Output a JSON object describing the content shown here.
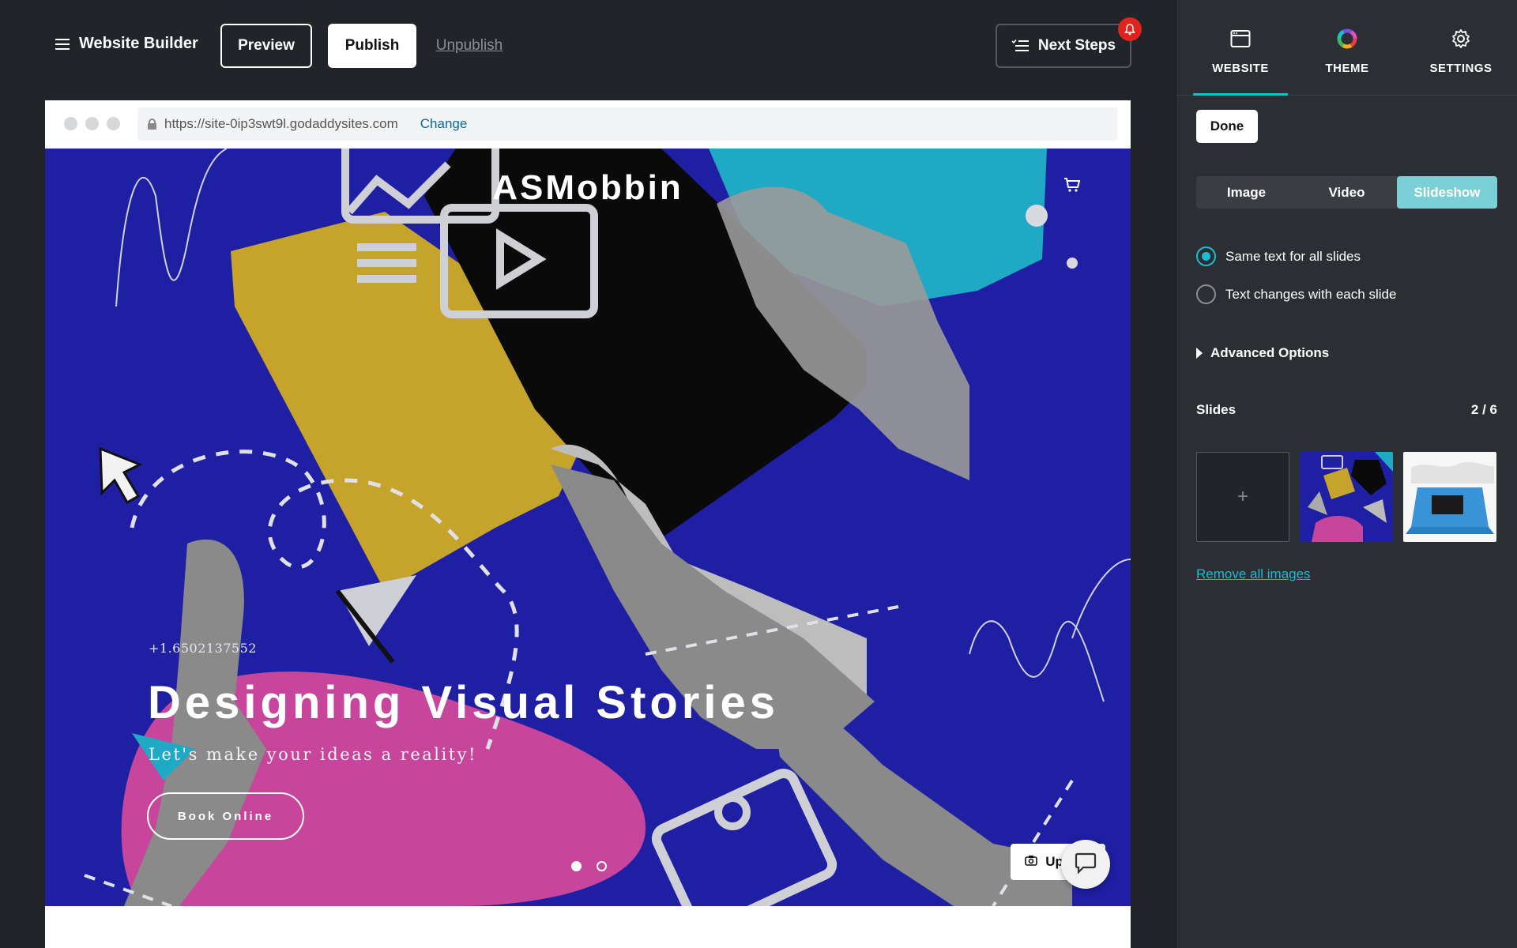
{
  "topbar": {
    "brand": "Website Builder",
    "preview_label": "Preview",
    "publish_label": "Publish",
    "unpublish_label": "Unpublish",
    "next_steps_label": "Next Steps",
    "bell_icon": "bell-icon"
  },
  "browser": {
    "url": "https://site-0ip3swt9l.godaddysites.com",
    "change_label": "Change"
  },
  "hero": {
    "site_title": "ASMobbin",
    "phone": "+1.6502137552",
    "headline": "Designing Visual Stories",
    "subline": "Let's make your ideas a reality!",
    "cta_label": "Book Online",
    "update_label": "Update",
    "slide_dots": 2,
    "active_slide_dot": 1
  },
  "panel": {
    "tabs": [
      {
        "label": "WEBSITE",
        "icon": "browser-window-icon",
        "active": true
      },
      {
        "label": "THEME",
        "icon": "color-wheel-icon",
        "active": false
      },
      {
        "label": "SETTINGS",
        "icon": "gear-icon",
        "active": false
      }
    ],
    "done_label": "Done",
    "media_types": [
      {
        "label": "Image",
        "selected": false
      },
      {
        "label": "Video",
        "selected": false
      },
      {
        "label": "Slideshow",
        "selected": true
      }
    ],
    "text_options": [
      {
        "label": "Same text for all slides",
        "checked": true
      },
      {
        "label": "Text changes with each slide",
        "checked": false
      }
    ],
    "advanced_label": "Advanced Options",
    "slides_label": "Slides",
    "slides_count": "2 / 6",
    "add_slide_symbol": "+",
    "remove_label": "Remove all images"
  },
  "colors": {
    "accent": "#1bbdd0",
    "hero_bg": "#1e1fa3",
    "panel_bg": "#2b2e33",
    "app_bg": "#212428",
    "slideshow_selected": "#7bcfd6",
    "alert": "#e0231c"
  }
}
